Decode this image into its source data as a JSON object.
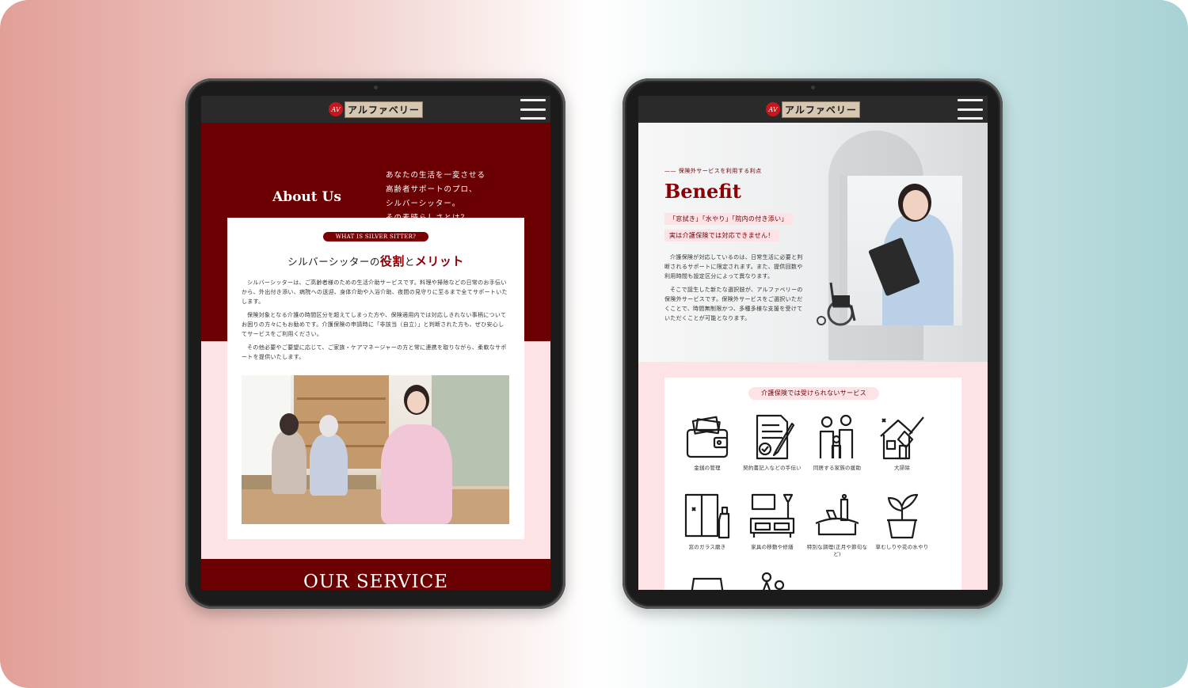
{
  "brand": {
    "logo_mark": "AV",
    "logo_text": "アルファベリー"
  },
  "left_screen": {
    "about_title": "About Us",
    "lead_lines": [
      "あなたの生活を一変させる",
      "高齢者サポートのプロ、",
      "シルバーシッター。",
      "その素晴らしさとは？"
    ],
    "badge": "WHAT IS SILVER SITTER?",
    "heading_pre": "シルバーシッターの",
    "heading_accent1": "役割",
    "heading_mid": "と",
    "heading_accent2": "メリット",
    "paragraphs": [
      "シルバーシッターは、ご高齢者様のための生活介助サービスです。料理や掃除などの日常のお手伝いから、外出付き添い、病院への送迎、身体介助や入浴介助、夜間の見守りに至るまで全てサポートいたします。",
      "保険対象となる介護の時間区分を超えてしまった方や、保険適用内では対応しきれない事柄についてお困りの方々にもお勧めです。介護保険の申請時に「非該当（自立）」と判断された方も、ぜひ安心してサービスをご利用ください。",
      "その他必要やご要望に応じて、ご家族・ケアマネージャーの方と常に連携を取りながら、柔軟なサポートを提供いたします。"
    ],
    "service_title": "OUR SERVICE"
  },
  "right_screen": {
    "eyebrow": "保険外サービスを利用する利点",
    "title": "Benefit",
    "tag1": "「窓拭き」「水やり」「院内の付き添い」",
    "tag2": "実は介護保険では対応できません！",
    "paragraphs": [
      "介護保険が対応しているのは、日常生活に必要と判断されるサポートに限定されます。また、提供回数や利用時間も設定区分によって異なります。",
      "そこで誕生した新たな選択肢が、アルファベリーの保険外サービスです。保険外サービスをご選択いただくことで、時間無制限かつ、多種多様な支援を受けていただくことが可能となります。"
    ],
    "section_pill": "介護保険では受けられないサービス",
    "services": [
      {
        "label": "金銭の管理",
        "icon": "wallet-icon"
      },
      {
        "label": "契約書記入などの手伝い",
        "icon": "contract-icon"
      },
      {
        "label": "同居する家族の援助",
        "icon": "family-icon"
      },
      {
        "label": "大掃除",
        "icon": "house-cleaning-icon"
      },
      {
        "label": "窓のガラス磨き",
        "icon": "window-cleaning-icon"
      },
      {
        "label": "家具の移動や修繕",
        "icon": "furniture-icon"
      },
      {
        "label": "特別な調理(正月や節句など)",
        "icon": "special-cooking-icon"
      },
      {
        "label": "草むしりや花の水やり",
        "icon": "plant-icon"
      }
    ]
  },
  "colors": {
    "maroon": "#6a0002",
    "accent_red": "#8a0006",
    "pink": "#fde3e6"
  }
}
